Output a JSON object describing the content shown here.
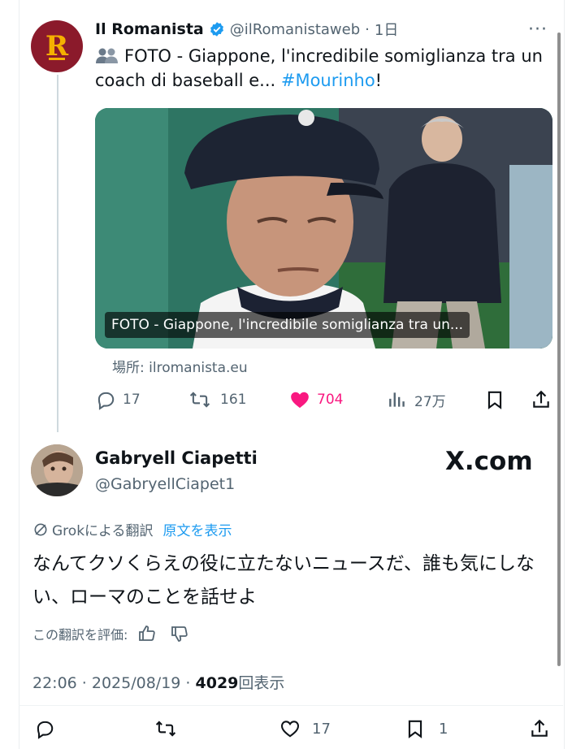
{
  "quoted_tweet": {
    "author_name": "Il Romanista",
    "handle": "@ilRomanistaweb",
    "time": "1日",
    "more": "···",
    "text_prefix": "FOTO - Giappone, l'incredibile somiglianza tra un coach di baseball e... ",
    "hashtag": "#Mourinho",
    "text_suffix": "!",
    "avatar_letter": "R",
    "media_caption": "FOTO - Giappone, l'incredibile somiglianza tra un...",
    "source": "場所: ilromanista.eu",
    "replies": "17",
    "reposts": "161",
    "likes": "704",
    "views": "27万"
  },
  "reply_tweet": {
    "author_name": "Gabryell Ciapetti",
    "handle": "@GabryellCiapet1",
    "watermark": "X.com",
    "grok_label": "Grokによる翻訳",
    "show_original": "原文を表示",
    "text": "なんてクソくらえの役に立たないニュースだ、誰も気にしない、ローマのことを話せよ",
    "rate_label": "この翻訳を評価:",
    "time": "22:06 · 2025/08/19 · ",
    "views_count": "4029",
    "views_label": "回表示",
    "likes": "17",
    "bookmarks": "1"
  },
  "colors": {
    "accent": "#1d9bf0",
    "like": "#f91880",
    "secondary_text": "#536471",
    "avatar_bg": "#8b1a2b",
    "avatar_letter": "#f5b000"
  }
}
